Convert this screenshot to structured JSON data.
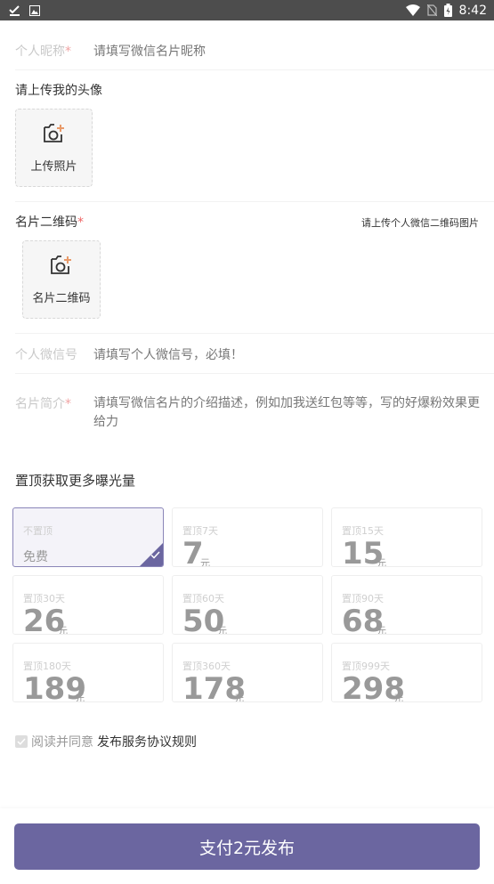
{
  "status_bar": {
    "time": "8:42"
  },
  "nickname": {
    "label": "个人昵称",
    "required_mark": "*",
    "placeholder": "请填写微信名片昵称"
  },
  "avatar": {
    "title": "请上传我的头像",
    "caption": "上传照片"
  },
  "qrcode": {
    "title": "名片二维码",
    "required_mark": "*",
    "hint": "请上传个人微信二维码图片",
    "caption": "名片二维码"
  },
  "wechat_id": {
    "label": "个人微信号",
    "placeholder": "请填写个人微信号，必填！"
  },
  "intro": {
    "label": "名片简介",
    "required_mark": "*",
    "placeholder_line1": "请填写微信名片的介绍描述，例如加我送红包等等，写的好爆粉效果更",
    "placeholder_line2": "给力"
  },
  "pin": {
    "title": "置顶获取更多曝光量",
    "options": [
      {
        "name": "不置顶",
        "value": "免费",
        "unit": ""
      },
      {
        "name": "置顶7天",
        "value": "7",
        "unit": "元"
      },
      {
        "name": "置顶15天",
        "value": "15",
        "unit": "元"
      },
      {
        "name": "置顶30天",
        "value": "26",
        "unit": "元"
      },
      {
        "name": "置顶60天",
        "value": "50",
        "unit": "元"
      },
      {
        "name": "置顶90天",
        "value": "68",
        "unit": "元"
      },
      {
        "name": "置顶180天",
        "value": "189",
        "unit": "元"
      },
      {
        "name": "置顶360天",
        "value": "178",
        "unit": "元"
      },
      {
        "name": "置顶999天",
        "value": "298",
        "unit": "元"
      }
    ]
  },
  "agreement": {
    "prefix": "阅读并同意",
    "link": "发布服务协议规则"
  },
  "pay_button": {
    "label": "支付2元发布"
  },
  "colors": {
    "accent": "#6b66a0",
    "status_bar": "#4d4d4d"
  }
}
